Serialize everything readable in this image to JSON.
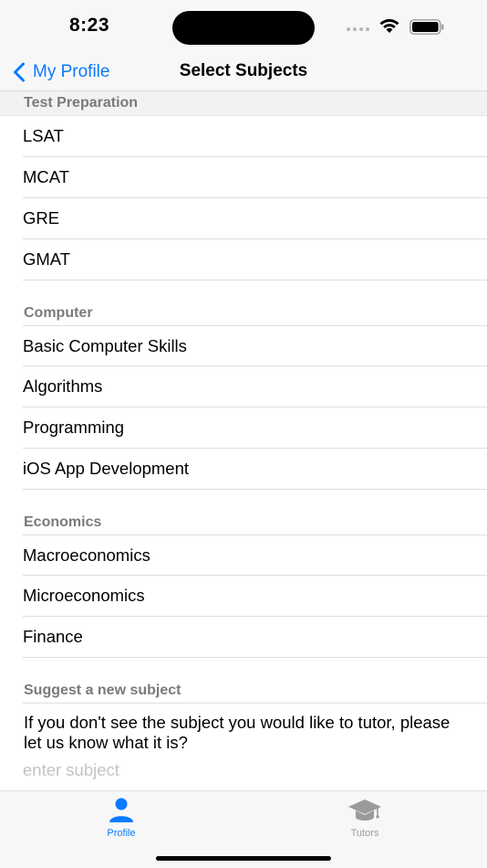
{
  "status_bar": {
    "time": "8:23"
  },
  "nav": {
    "back_label": "My Profile",
    "title": "Select Subjects"
  },
  "sections": [
    {
      "header": "Test Preparation",
      "items": [
        "LSAT",
        "MCAT",
        "GRE",
        "GMAT"
      ]
    },
    {
      "header": "Computer",
      "items": [
        "Basic Computer Skills",
        "Algorithms",
        "Programming",
        "iOS App Development"
      ]
    },
    {
      "header": "Economics",
      "items": [
        "Macroeconomics",
        "Microeconomics",
        "Finance"
      ]
    }
  ],
  "suggest": {
    "header": "Suggest a new subject",
    "text": "If you don't see the subject you would like to tutor, please let us know what it is?",
    "placeholder": "enter subject"
  },
  "tab_bar": {
    "tabs": [
      {
        "label": "Profile",
        "icon": "person-icon",
        "active": true
      },
      {
        "label": "Tutors",
        "icon": "graduation-cap-icon",
        "active": false
      }
    ]
  },
  "colors": {
    "accent": "#0a7aff",
    "inactive": "#9a9a9a"
  }
}
